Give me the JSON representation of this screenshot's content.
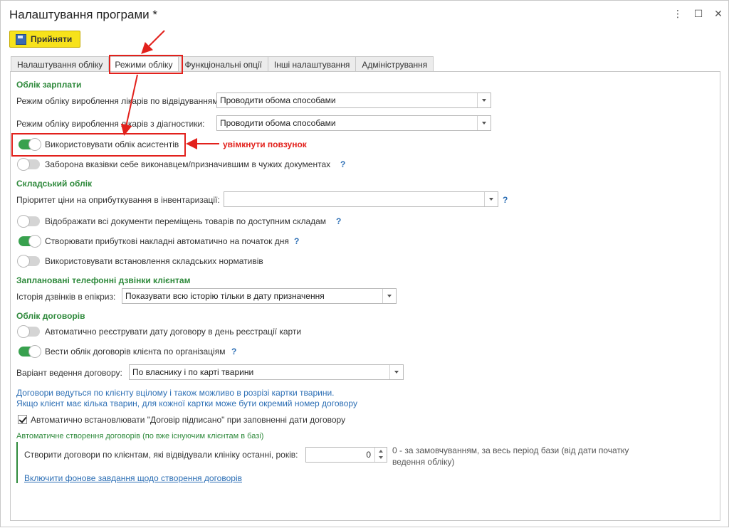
{
  "window": {
    "title": "Налаштування програми *",
    "controls": {
      "more": "⋮",
      "restore": "☐",
      "close": "✕"
    }
  },
  "toolbar": {
    "accept_label": "Прийняти"
  },
  "tabs": [
    {
      "label": "Налаштування обліку"
    },
    {
      "label": "Режими обліку"
    },
    {
      "label": "Функціональні опції"
    },
    {
      "label": "Інші налаштування"
    },
    {
      "label": "Адміністрування"
    }
  ],
  "salary": {
    "heading": "Облік зарплати",
    "visit_mode_label": "Режим обліку вироблення лікарів по відвідуванням:",
    "visit_mode_value": "Проводити обома способами",
    "diag_mode_label": "Режим обліку вироблення лікарів з діагностики:",
    "diag_mode_value": "Проводити обома способами",
    "assistants_label": "Використовувати облік асистентів",
    "assistants_on": true,
    "forbid_self_label": "Заборона вказівки себе виконавцем/призначившим в чужих документах",
    "forbid_self_on": false
  },
  "warehouse": {
    "heading": "Складський облік",
    "price_priority_label": "Пріоритет ціни на оприбуткування в інвентаризації:",
    "price_priority_value": "",
    "show_moves_label": "Відображати всі документи переміщень товарів по доступним складам",
    "show_moves_on": false,
    "create_invoices_label": "Створювати прибуткові накладні автоматично на початок дня",
    "create_invoices_on": true,
    "norms_label": "Використовувати встановлення складських нормативів",
    "norms_on": false
  },
  "calls": {
    "heading": "Заплановані телефонні дзвінки клієнтам",
    "history_label": "Історія дзвінків в епікриз:",
    "history_value": "Показувати всю історію тільки в дату призначення"
  },
  "contracts": {
    "heading": "Облік договорів",
    "auto_register_label": "Автоматично реєструвати дату договору в день реєстрації карти",
    "auto_register_on": false,
    "by_org_label": "Вести облік договорів клієнта по організаціям",
    "by_org_on": true,
    "variant_label": "Варіант ведення договору:",
    "variant_value": "По власнику і по карті тварини",
    "info_line1": "Договори ведуться по клієнту вцілому і також можливо в розрізі картки тварини.",
    "info_line2": "Якщо клієнт має кілька тварин, для кожної картки може бути окремий номер договору",
    "auto_signed_label": "Автоматично встановлювати \"Договір підписано\" при заповненні дати договору",
    "auto_signed_checked": true,
    "auto_create_heading": "Автоматичне створення договорів (по вже існуючим клієнтам в базі)",
    "create_by_clients_label": "Створити договори по клієнтам, які відвідували клініку останні, років:",
    "years_value": "0",
    "years_hint_line1": "0 - за замовчуванням, за весь період бази (від дати початку",
    "years_hint_line2": "ведення обліку)",
    "bg_task_link": "Включити фонове завдання щодо створення договорів"
  },
  "help_mark": "?",
  "annotation": {
    "text": "увімкнути повзунок"
  },
  "colors": {
    "accent_green": "#2f8a3c",
    "toggle_on": "#38a14e",
    "accept_yellow": "#f7e21b",
    "annotation_red": "#e2211c",
    "link_blue": "#2d6fb5"
  }
}
